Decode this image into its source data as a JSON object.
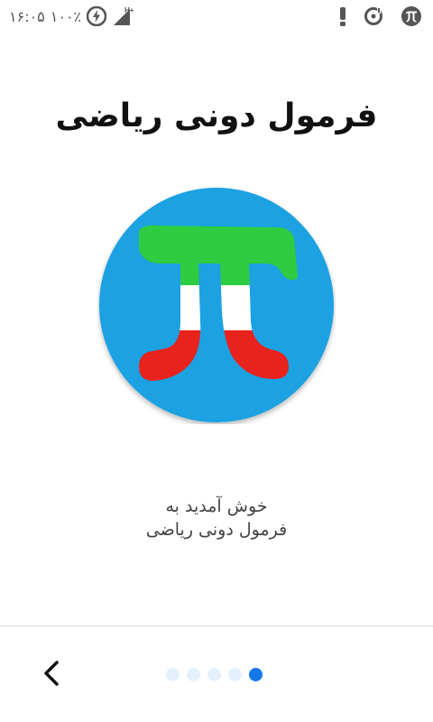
{
  "status_bar": {
    "time": "۱۶:۰۵",
    "battery": "۱۰۰٪",
    "icons": [
      "charging-circle-icon",
      "signal-h-plus-icon",
      "alert-icon",
      "record-icon",
      "pi-app-icon"
    ],
    "network_label": "H+"
  },
  "header": {
    "title": "فرمول دونی ریاضی"
  },
  "logo": {
    "symbol": "π",
    "background_color": "#1ba1e2",
    "flag_colors": [
      "#2ecc40",
      "#ffffff",
      "#e8231d"
    ]
  },
  "welcome": {
    "line1": "خوش آمدید به",
    "line2": "فرمول دونی ریاضی"
  },
  "pager": {
    "count": 5,
    "active_index": 4,
    "active_color": "#1677e8",
    "inactive_color": "#e3f1fb"
  },
  "nav": {
    "back_icon": "chevron-left-icon"
  }
}
